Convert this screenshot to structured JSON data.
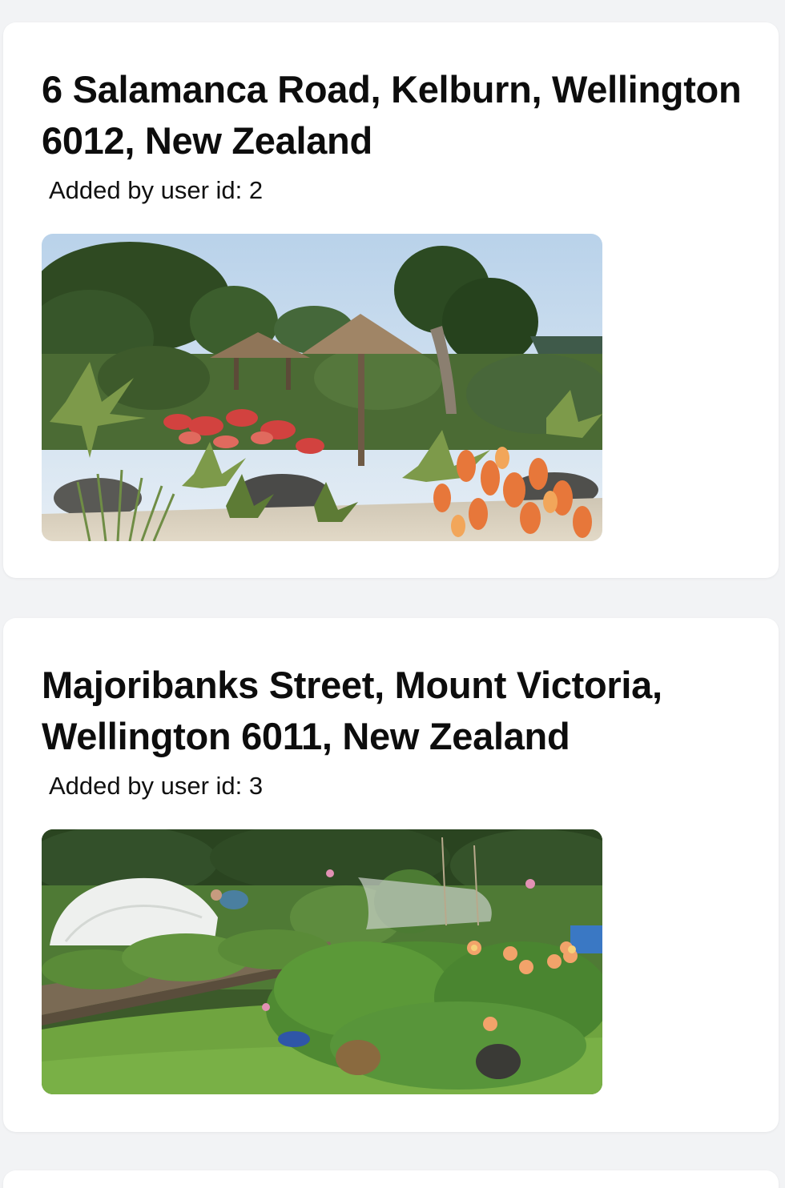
{
  "posts": [
    {
      "address": "6 Salamanca Road, Kelburn, Wellington 6012, New Zealand",
      "added_by": "Added by user id: 2"
    },
    {
      "address": "Majoribanks Street, Mount Victoria, Wellington 6011, New Zealand",
      "added_by": "Added by user id: 3"
    }
  ],
  "colors": {
    "background": "#f2f3f5",
    "card": "#ffffff",
    "title_text": "#0d0d0d"
  }
}
